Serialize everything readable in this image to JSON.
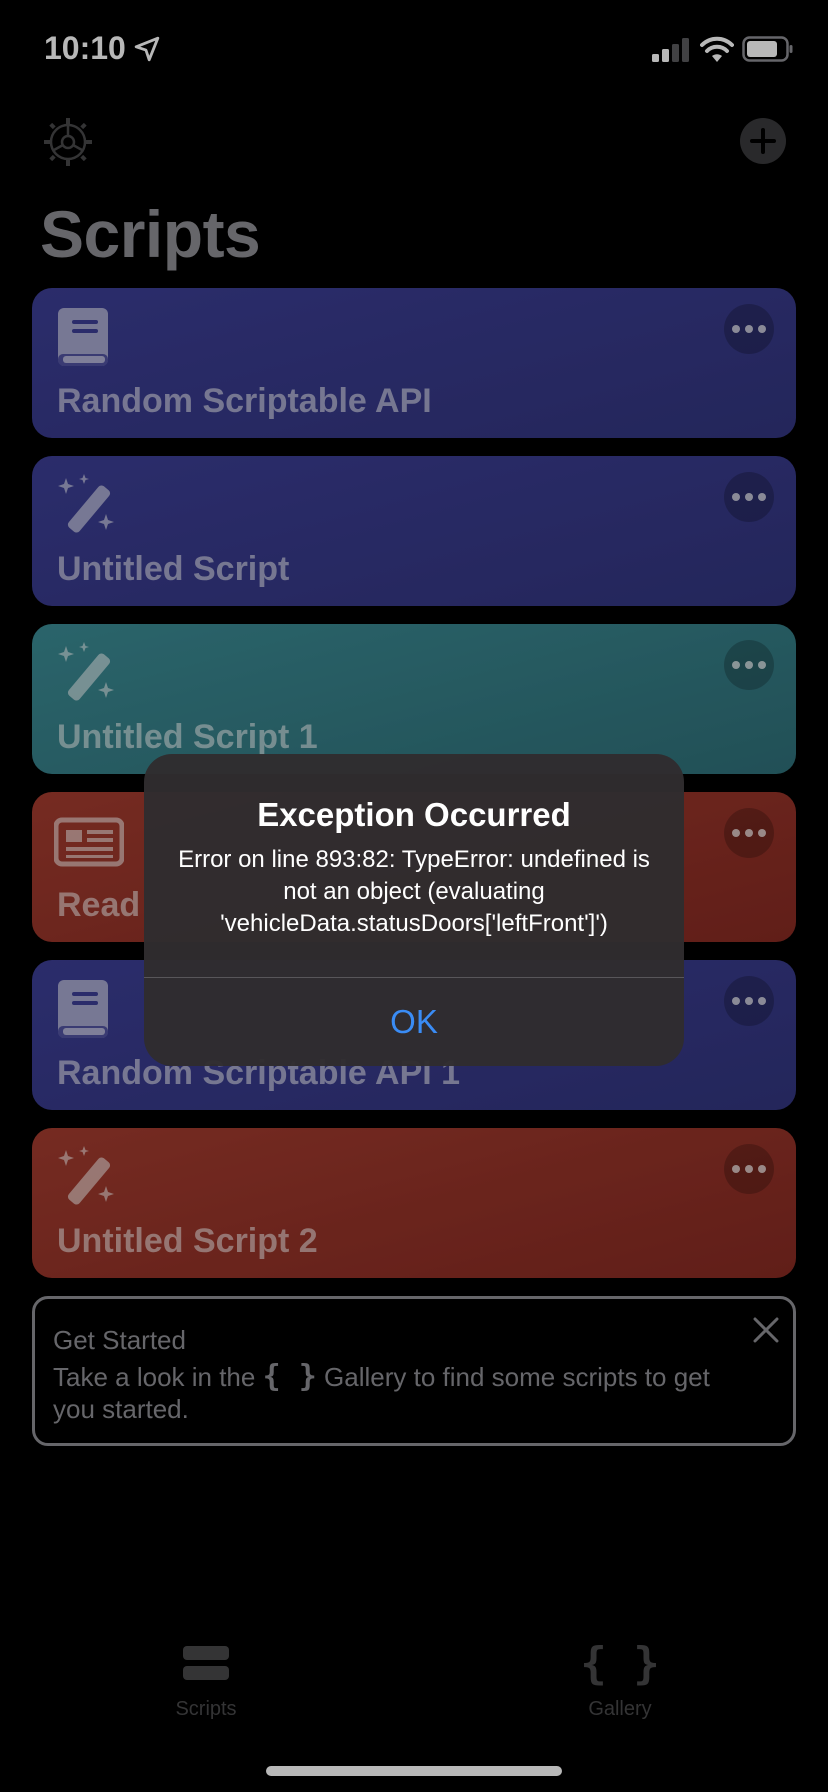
{
  "status_bar": {
    "time": "10:10"
  },
  "header": {
    "title": "Scripts"
  },
  "scripts": [
    {
      "title": "Random Scriptable API",
      "icon": "book-icon",
      "color": "#3c3e95"
    },
    {
      "title": "Untitled Script",
      "icon": "magic-wand-icon",
      "color": "#3c3e95"
    },
    {
      "title": "Untitled Script 1",
      "icon": "magic-wand-icon",
      "color": "#3b8b94"
    },
    {
      "title": "Read",
      "icon": "newspaper-icon",
      "color": "#a33c2f"
    },
    {
      "title": "Random Scriptable API 1",
      "icon": "book-icon",
      "color": "#3c3e95"
    },
    {
      "title": "Untitled Script 2",
      "icon": "magic-wand-icon",
      "color": "#a33c2f"
    }
  ],
  "get_started": {
    "title": "Get Started",
    "text_before": "Take a look in the",
    "braces": "{ }",
    "text_after": "Gallery to find some scripts to get you started."
  },
  "tabs": {
    "scripts": "Scripts",
    "gallery": "Gallery",
    "gallery_glyph": "{ }"
  },
  "alert": {
    "title": "Exception Occurred",
    "message": "Error on line 893:82: TypeError: undefined is not an object (evaluating 'vehicleData.statusDoors['leftFront']')",
    "ok": "OK",
    "ok_color": "#3a8cf5"
  }
}
